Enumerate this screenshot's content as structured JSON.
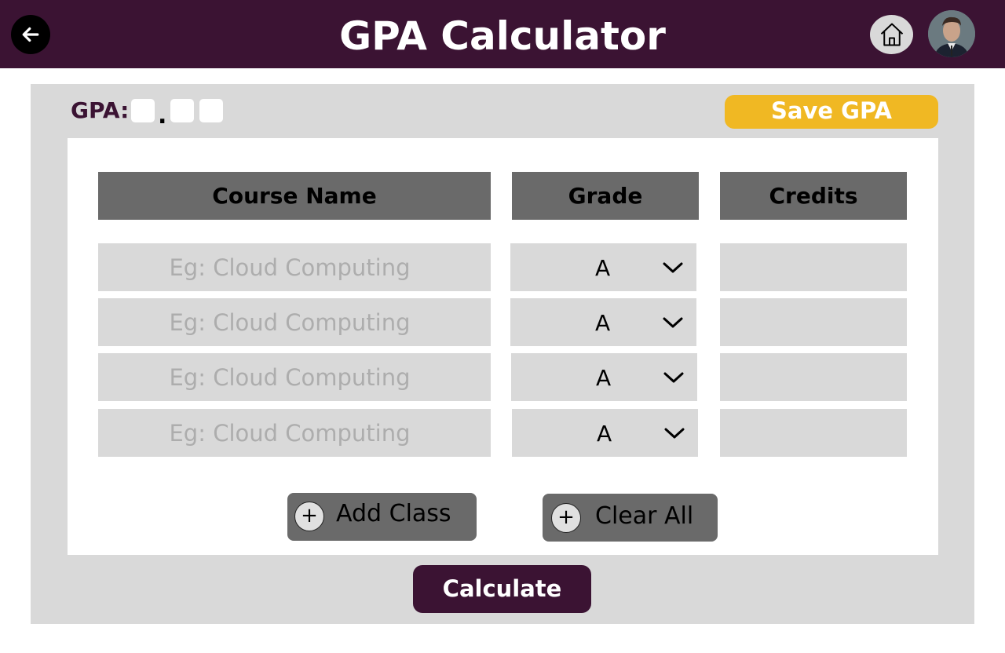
{
  "header": {
    "title": "GPA Calculator",
    "back_icon": "arrow-left-icon",
    "home_icon": "home-icon",
    "avatar_icon": "user-avatar"
  },
  "gpa": {
    "label": "GPA:",
    "digits": [
      "",
      "",
      ""
    ],
    "save_label": "Save GPA"
  },
  "table": {
    "headers": {
      "course": "Course Name",
      "grade": "Grade",
      "credits": "Credits"
    },
    "rows": [
      {
        "course": "",
        "course_placeholder": "Eg: Cloud Computing",
        "grade": "A",
        "credits": ""
      },
      {
        "course": "",
        "course_placeholder": "Eg: Cloud Computing",
        "grade": "A",
        "credits": ""
      },
      {
        "course": "",
        "course_placeholder": "Eg: Cloud Computing",
        "grade": "A",
        "credits": ""
      },
      {
        "course": "",
        "course_placeholder": "Eg: Cloud Computing",
        "grade": "A",
        "credits": ""
      }
    ]
  },
  "actions": {
    "add_class_label": "Add Class",
    "clear_all_label": "Clear All",
    "plus_symbol": "+",
    "calculate_label": "Calculate"
  },
  "colors": {
    "header_bg": "#3b1333",
    "save_button": "#f0b823",
    "panel_bg": "#d9d9d9",
    "column_header_bg": "#6a6a6a"
  }
}
